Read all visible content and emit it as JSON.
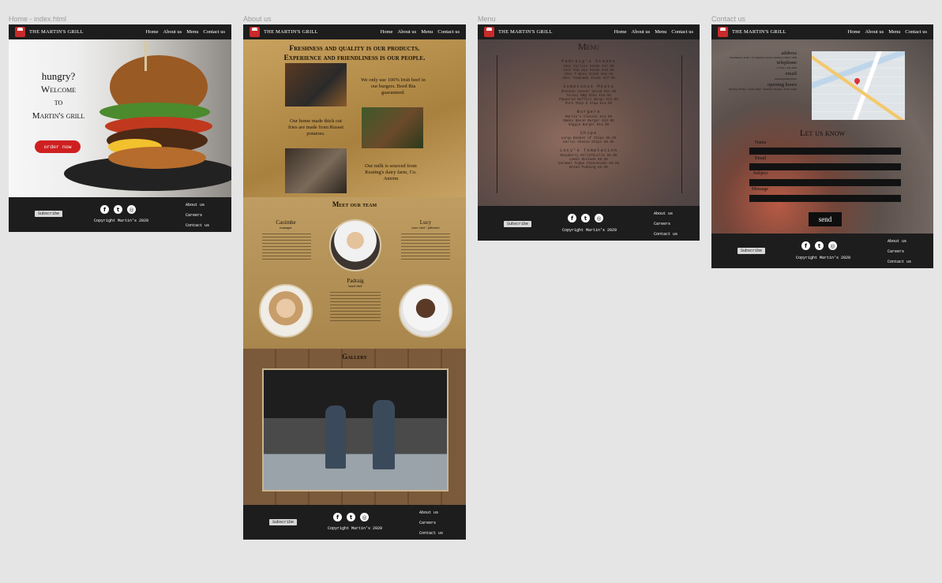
{
  "frames": {
    "home": "Home - index.html",
    "about": "About us",
    "menu": "Menu",
    "contact": "Contact us"
  },
  "brand": "THE MARTIN'S GRILL",
  "nav": [
    "Home",
    "About us",
    "Menu",
    "Contact us"
  ],
  "home": {
    "line1": "hungry?",
    "line2": "Welcome",
    "line3": "to",
    "line4": "Martin's grill",
    "cta": "order now"
  },
  "about": {
    "hero1": "Freshness and quality is our products.",
    "hero2": "Experience and friendliness is our people.",
    "p1": "We only use 100% Irish beef in our burgers. Bord Bia guaranteed.",
    "p2": "Our home made thick cut fries are made from Russet potatoes.",
    "p3": "Our milk is sourced from Keating's dairy farm, Co. Antrim",
    "team_title": "Meet our team",
    "m1_name": "Caoimhe",
    "m1_role": "manager",
    "m2_name": "Lucy",
    "m2_role": "sous-chef / pâtissier",
    "m3_name": "Padraig",
    "m3_role": "head chef",
    "gallery": "Gallery"
  },
  "menu": {
    "title": "Menu",
    "sections": [
      {
        "h": "Padraig's Steaks",
        "items": [
          "10oz Sirloin Steak €17.95",
          "12oz Rib Eye Steak €19.95",
          "10oz T-Bone Steak €18.95",
          "16oz Tomahawk Steak €27.95"
        ]
      },
      {
        "h": "Sumptuous Meats",
        "items": [
          "Chicken Caesar Salad €14.95",
          "Turkey BBQ Ribs €16.95",
          "Peppered Buffalo Wings €11.95",
          "Pork Chop & Slaw €14.95"
        ]
      },
      {
        "h": "Burgers",
        "items": [
          "Martin's Classic €12.95",
          "Smoky Bacon Burger €13.95",
          "Veggie Burger €11.95"
        ]
      },
      {
        "h": "Chips",
        "items": [
          "Large Basket of Chips €5.95",
          "Garlic Cheese Chips €6.95"
        ]
      },
      {
        "h": "Lucy's Temptation",
        "items": [
          "Raspberry Millefeuille €6.95",
          "Lemon Roulade €6.95",
          "Caramel Fudge Cheesecake €6.95",
          "Bread Pudding €5.95"
        ]
      }
    ]
  },
  "contact": {
    "address_h": "address",
    "address": "The Martin's Grill, 1 St Stephen's Green, Dublin 2, D02 F 5FH",
    "phone_h": "telephone",
    "phone": "(+353) 1 442 4500",
    "email_h": "email",
    "email": "martinsgrill@grill.ie",
    "hours_h": "opening hours",
    "hours": "Monday–Friday: 12pm–10pm · Saturday–Sunday: 11am–11pm",
    "form_title": "Let us know",
    "fields": [
      "Name",
      "Email",
      "Subject",
      "Message"
    ],
    "send": "send"
  },
  "footer": {
    "subscribe": "Subscribe",
    "copyright": "Copyright Martin's 2020",
    "links": [
      "About us",
      "Careers",
      "Contact us"
    ],
    "social": [
      "f",
      "t",
      "◎"
    ]
  }
}
